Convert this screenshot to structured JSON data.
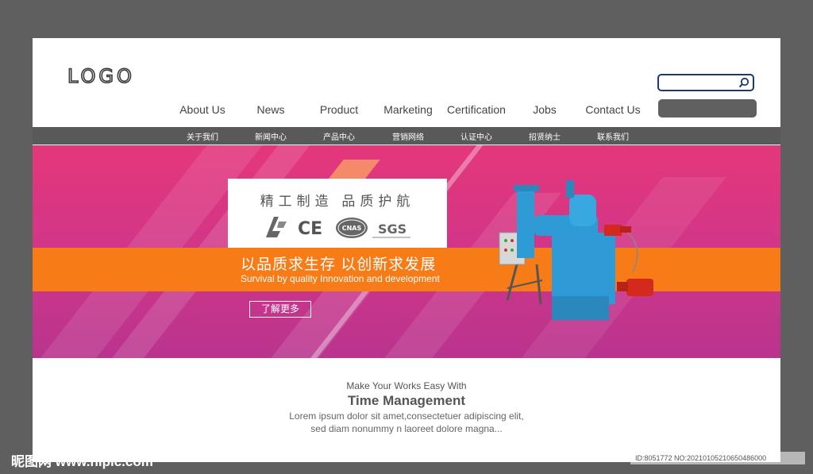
{
  "header": {
    "logo": "LOGO"
  },
  "search": {
    "placeholder": ""
  },
  "nav": [
    {
      "label": "About Us"
    },
    {
      "label": "News"
    },
    {
      "label": "Product"
    },
    {
      "label": "Marketing"
    },
    {
      "label": "Certification"
    },
    {
      "label": "Jobs"
    },
    {
      "label": "Contact Us"
    }
  ],
  "subnav": [
    {
      "label": "关于我们"
    },
    {
      "label": "新闻中心"
    },
    {
      "label": "产品中心"
    },
    {
      "label": "营销网络"
    },
    {
      "label": "认证中心"
    },
    {
      "label": "招贤纳士"
    },
    {
      "label": "联系我们"
    }
  ],
  "banner": {
    "slogan_cn": "精工制造 品质护航",
    "cert_icons": [
      "CE",
      "CNAS",
      "SGS"
    ],
    "headline_cn": "以品质求生存 以创新求发展",
    "headline_en": "Survival by quality  Innovation and development",
    "more_button": "了解更多"
  },
  "section": {
    "subtitle": "Make Your Works Easy With",
    "title": "Time Management",
    "body_line1": "Lorem ipsum dolor sit amet,consectetuer adipiscing elit,",
    "body_line2": "sed diam nonummy n laoreet dolore magna..."
  },
  "watermark": {
    "left": "昵图网 www.nipic.com",
    "right": "ID:8051772 NO:20210105210650486000"
  },
  "colors": {
    "frame": "#5f5f5f",
    "subbar": "#595959",
    "banner_top": "#e4377a",
    "banner_bottom": "#b9348f",
    "orange": "#f77b16",
    "machine_blue": "#2f9bd6",
    "search_border": "#1c3a6e"
  }
}
